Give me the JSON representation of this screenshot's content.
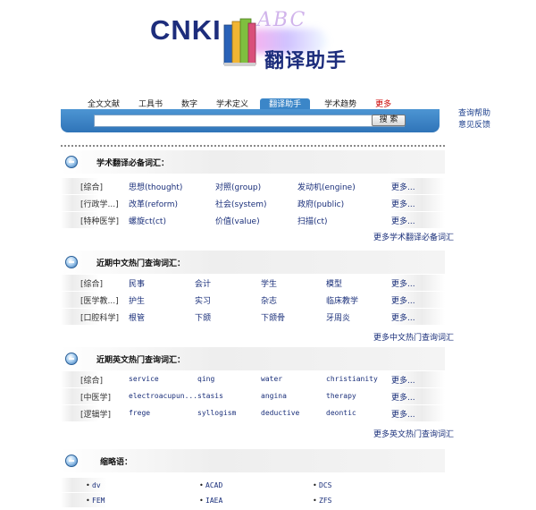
{
  "logo": {
    "cnki": "CNKI",
    "script": "ABC",
    "title": "翻译助手"
  },
  "tabs": [
    {
      "label": "全文文献",
      "active": false
    },
    {
      "label": "工具书",
      "active": false
    },
    {
      "label": "数字",
      "active": false
    },
    {
      "label": "学术定义",
      "active": false
    },
    {
      "label": "翻译助手",
      "active": true
    },
    {
      "label": "学术趋势",
      "active": false
    },
    {
      "label": "更多",
      "active": false
    }
  ],
  "search": {
    "value": "",
    "placeholder": "",
    "button_label": "搜 索"
  },
  "side_links": [
    "查询帮助",
    "意见反馈"
  ],
  "colors": {
    "bar": "#3b86c8",
    "link": "#1a2f7a",
    "more_tab": "#cc0000",
    "logo": "#1d2d7c"
  },
  "sections": [
    {
      "title": "学术翻译必备词汇：",
      "footer": "更多学术翻译必备词汇",
      "rows": [
        {
          "category": "[综合]",
          "terms": [
            "思想(thought)",
            "对照(group)",
            "发动机(engine)"
          ],
          "more": "更多..."
        },
        {
          "category": "[行政学...]",
          "terms": [
            "改革(reform)",
            "社会(system)",
            "政府(public)"
          ],
          "more": "更多..."
        },
        {
          "category": "[特种医学]",
          "terms": [
            "螺旋ct(ct)",
            "价值(value)",
            "扫描(ct)"
          ],
          "more": "更多..."
        }
      ]
    },
    {
      "title": "近期中文热门查询词汇：",
      "footer": "更多中文热门查询词汇",
      "rows": [
        {
          "category": "[综合]",
          "terms": [
            "民事",
            "会计",
            "学生",
            "模型"
          ],
          "more": "更多..."
        },
        {
          "category": "[医学教...]",
          "terms": [
            "护生",
            "实习",
            "杂志",
            "临床教学"
          ],
          "more": "更多..."
        },
        {
          "category": "[口腔科学]",
          "terms": [
            "根管",
            "下颌",
            "下颌骨",
            "牙周炎"
          ],
          "more": "更多..."
        }
      ]
    },
    {
      "title": "近期英文热门查询词汇：",
      "footer": "更多英文热门查询词汇",
      "rows": [
        {
          "category": "[综合]",
          "terms": [
            "service",
            "qing",
            "water",
            "christianity"
          ],
          "more": "更多..."
        },
        {
          "category": "[中医学]",
          "terms": [
            "electroacupun...",
            "stasis",
            "angina",
            "therapy"
          ],
          "more": "更多..."
        },
        {
          "category": "[逻辑学]",
          "terms": [
            "frege",
            "syllogism",
            "deductive",
            "deontic"
          ],
          "more": "更多..."
        }
      ]
    }
  ],
  "abbreviations": {
    "title": "缩略语：",
    "rows": [
      [
        "dv",
        "ACAD",
        "DCS"
      ],
      [
        "FEM",
        "IAEA",
        "ZFS"
      ]
    ]
  }
}
